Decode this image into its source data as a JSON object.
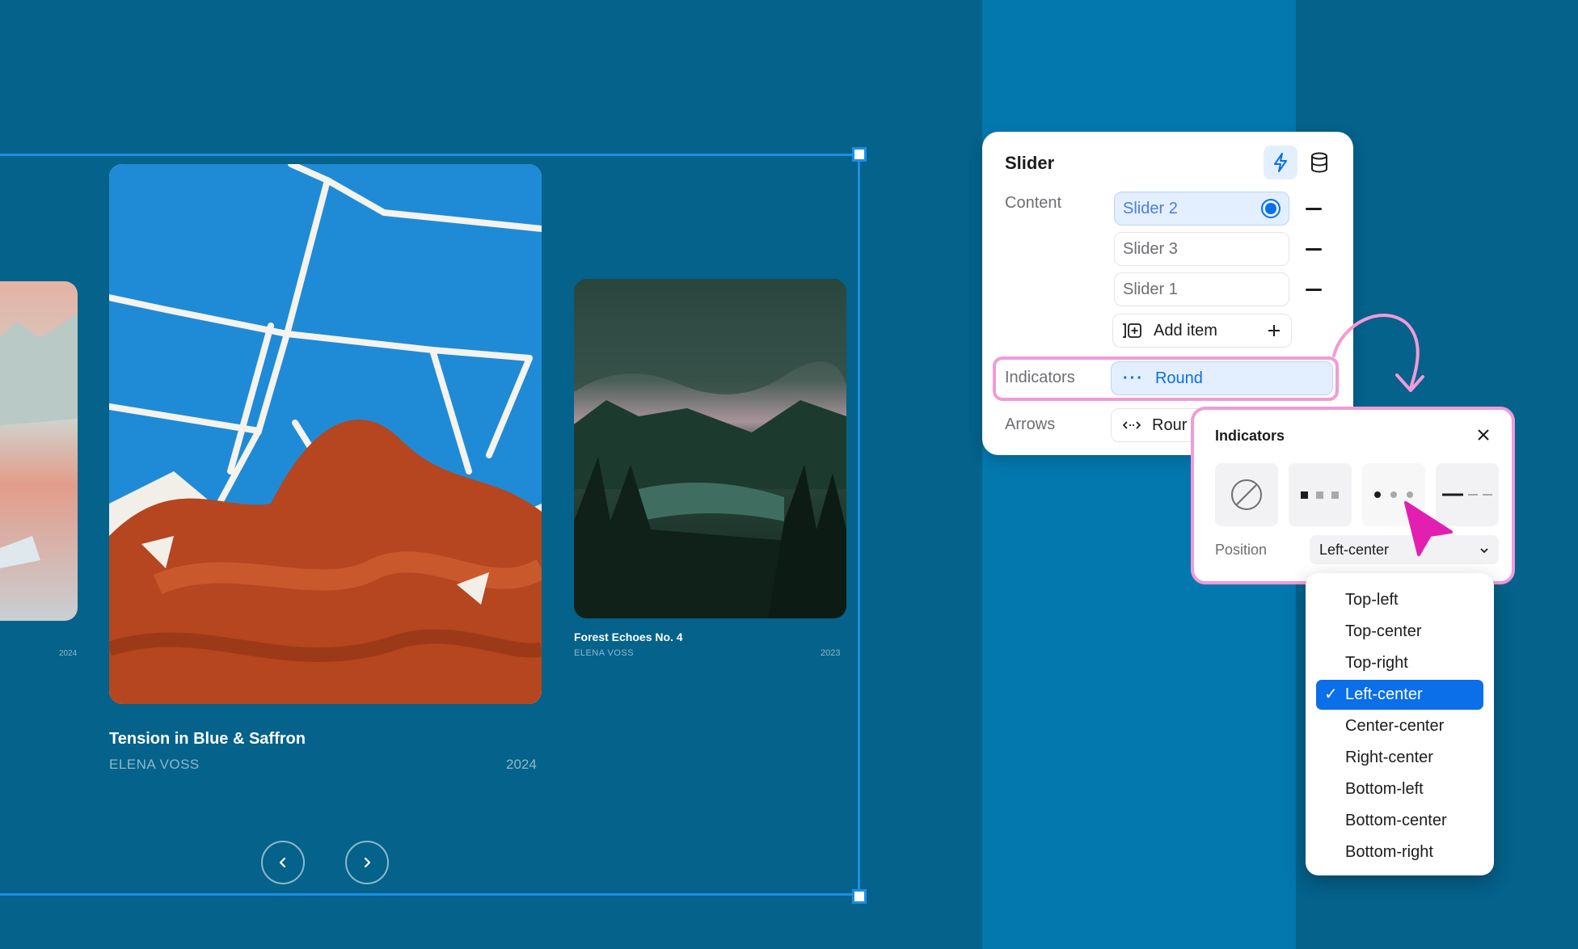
{
  "slides": [
    {
      "title": "",
      "artist": "",
      "year": "2024"
    },
    {
      "title": "Tension in Blue & Saffron",
      "artist": "ELENA VOSS",
      "year": "2024"
    },
    {
      "title": "Forest Echoes No. 4",
      "artist": "ELENA VOSS",
      "year": "2023"
    }
  ],
  "nav": {
    "prev_icon": "chevron-left-icon",
    "next_icon": "chevron-right-icon"
  },
  "panel": {
    "title": "Slider",
    "content_label": "Content",
    "content_items": [
      {
        "label": "Slider 2",
        "selected": true
      },
      {
        "label": "Slider 3",
        "selected": false
      },
      {
        "label": "Slider 1",
        "selected": false
      }
    ],
    "add_item_label": "Add item",
    "indicators_label": "Indicators",
    "indicators_value": "Round",
    "arrows_label": "Arrows",
    "arrows_value": "Rour"
  },
  "popover": {
    "title": "Indicators",
    "styles": [
      "none",
      "squares",
      "dots",
      "lines"
    ],
    "position_label": "Position",
    "position_value": "Left-center"
  },
  "dropdown": {
    "options": [
      "Top-left",
      "Top-center",
      "Top-right",
      "Left-center",
      "Center-center",
      "Right-center",
      "Bottom-left",
      "Bottom-center",
      "Bottom-right"
    ],
    "selected": "Left-center"
  },
  "colors": {
    "accent": "#0a6fe8",
    "highlight": "#f29ad8",
    "cursor": "#e21fb0",
    "background": "#04628b"
  }
}
